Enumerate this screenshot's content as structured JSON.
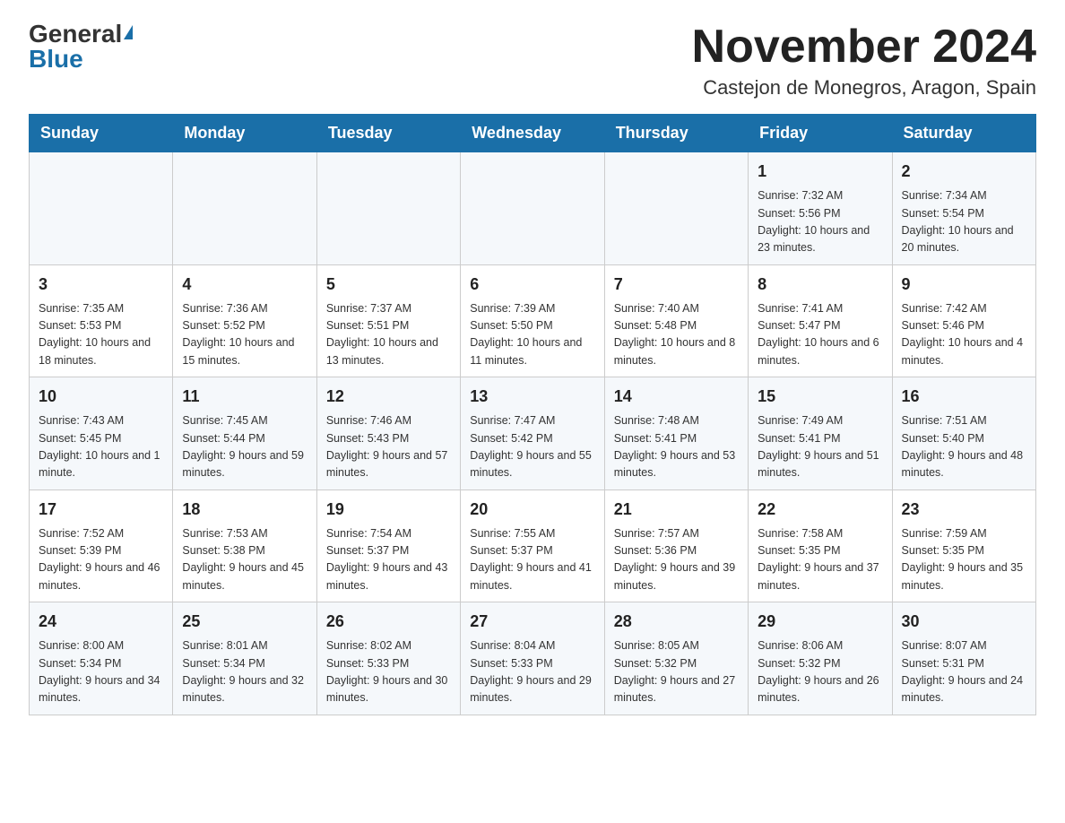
{
  "header": {
    "logo_general": "General",
    "logo_blue": "Blue",
    "month_title": "November 2024",
    "location": "Castejon de Monegros, Aragon, Spain"
  },
  "weekdays": [
    "Sunday",
    "Monday",
    "Tuesday",
    "Wednesday",
    "Thursday",
    "Friday",
    "Saturday"
  ],
  "weeks": [
    [
      {
        "day": "",
        "info": ""
      },
      {
        "day": "",
        "info": ""
      },
      {
        "day": "",
        "info": ""
      },
      {
        "day": "",
        "info": ""
      },
      {
        "day": "",
        "info": ""
      },
      {
        "day": "1",
        "info": "Sunrise: 7:32 AM\nSunset: 5:56 PM\nDaylight: 10 hours and 23 minutes."
      },
      {
        "day": "2",
        "info": "Sunrise: 7:34 AM\nSunset: 5:54 PM\nDaylight: 10 hours and 20 minutes."
      }
    ],
    [
      {
        "day": "3",
        "info": "Sunrise: 7:35 AM\nSunset: 5:53 PM\nDaylight: 10 hours and 18 minutes."
      },
      {
        "day": "4",
        "info": "Sunrise: 7:36 AM\nSunset: 5:52 PM\nDaylight: 10 hours and 15 minutes."
      },
      {
        "day": "5",
        "info": "Sunrise: 7:37 AM\nSunset: 5:51 PM\nDaylight: 10 hours and 13 minutes."
      },
      {
        "day": "6",
        "info": "Sunrise: 7:39 AM\nSunset: 5:50 PM\nDaylight: 10 hours and 11 minutes."
      },
      {
        "day": "7",
        "info": "Sunrise: 7:40 AM\nSunset: 5:48 PM\nDaylight: 10 hours and 8 minutes."
      },
      {
        "day": "8",
        "info": "Sunrise: 7:41 AM\nSunset: 5:47 PM\nDaylight: 10 hours and 6 minutes."
      },
      {
        "day": "9",
        "info": "Sunrise: 7:42 AM\nSunset: 5:46 PM\nDaylight: 10 hours and 4 minutes."
      }
    ],
    [
      {
        "day": "10",
        "info": "Sunrise: 7:43 AM\nSunset: 5:45 PM\nDaylight: 10 hours and 1 minute."
      },
      {
        "day": "11",
        "info": "Sunrise: 7:45 AM\nSunset: 5:44 PM\nDaylight: 9 hours and 59 minutes."
      },
      {
        "day": "12",
        "info": "Sunrise: 7:46 AM\nSunset: 5:43 PM\nDaylight: 9 hours and 57 minutes."
      },
      {
        "day": "13",
        "info": "Sunrise: 7:47 AM\nSunset: 5:42 PM\nDaylight: 9 hours and 55 minutes."
      },
      {
        "day": "14",
        "info": "Sunrise: 7:48 AM\nSunset: 5:41 PM\nDaylight: 9 hours and 53 minutes."
      },
      {
        "day": "15",
        "info": "Sunrise: 7:49 AM\nSunset: 5:41 PM\nDaylight: 9 hours and 51 minutes."
      },
      {
        "day": "16",
        "info": "Sunrise: 7:51 AM\nSunset: 5:40 PM\nDaylight: 9 hours and 48 minutes."
      }
    ],
    [
      {
        "day": "17",
        "info": "Sunrise: 7:52 AM\nSunset: 5:39 PM\nDaylight: 9 hours and 46 minutes."
      },
      {
        "day": "18",
        "info": "Sunrise: 7:53 AM\nSunset: 5:38 PM\nDaylight: 9 hours and 45 minutes."
      },
      {
        "day": "19",
        "info": "Sunrise: 7:54 AM\nSunset: 5:37 PM\nDaylight: 9 hours and 43 minutes."
      },
      {
        "day": "20",
        "info": "Sunrise: 7:55 AM\nSunset: 5:37 PM\nDaylight: 9 hours and 41 minutes."
      },
      {
        "day": "21",
        "info": "Sunrise: 7:57 AM\nSunset: 5:36 PM\nDaylight: 9 hours and 39 minutes."
      },
      {
        "day": "22",
        "info": "Sunrise: 7:58 AM\nSunset: 5:35 PM\nDaylight: 9 hours and 37 minutes."
      },
      {
        "day": "23",
        "info": "Sunrise: 7:59 AM\nSunset: 5:35 PM\nDaylight: 9 hours and 35 minutes."
      }
    ],
    [
      {
        "day": "24",
        "info": "Sunrise: 8:00 AM\nSunset: 5:34 PM\nDaylight: 9 hours and 34 minutes."
      },
      {
        "day": "25",
        "info": "Sunrise: 8:01 AM\nSunset: 5:34 PM\nDaylight: 9 hours and 32 minutes."
      },
      {
        "day": "26",
        "info": "Sunrise: 8:02 AM\nSunset: 5:33 PM\nDaylight: 9 hours and 30 minutes."
      },
      {
        "day": "27",
        "info": "Sunrise: 8:04 AM\nSunset: 5:33 PM\nDaylight: 9 hours and 29 minutes."
      },
      {
        "day": "28",
        "info": "Sunrise: 8:05 AM\nSunset: 5:32 PM\nDaylight: 9 hours and 27 minutes."
      },
      {
        "day": "29",
        "info": "Sunrise: 8:06 AM\nSunset: 5:32 PM\nDaylight: 9 hours and 26 minutes."
      },
      {
        "day": "30",
        "info": "Sunrise: 8:07 AM\nSunset: 5:31 PM\nDaylight: 9 hours and 24 minutes."
      }
    ]
  ]
}
